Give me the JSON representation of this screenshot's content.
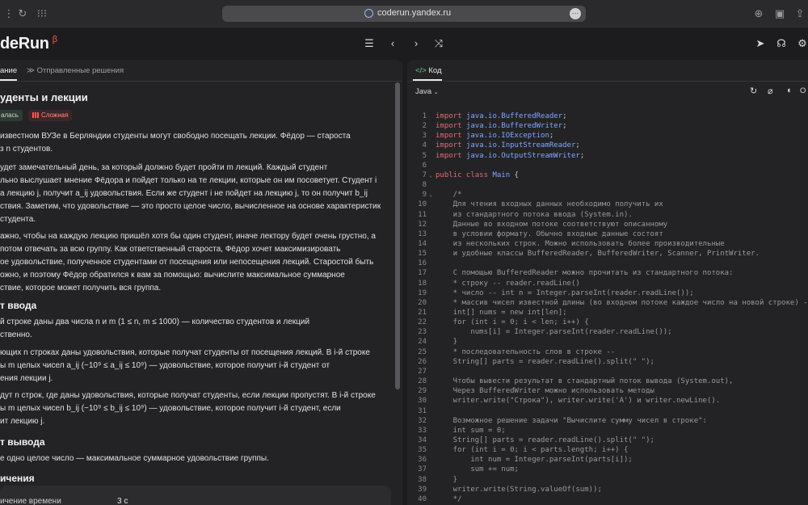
{
  "browser": {
    "url": "coderun.yandex.ru"
  },
  "app": {
    "logo": "deRun",
    "beta": "β"
  },
  "left_panel": {
    "tabs": [
      "ание",
      "Отправленные решения"
    ],
    "problem": {
      "title": "уденты и лекции",
      "badge_status": "алась",
      "badge_difficulty": "Сложная",
      "statement": [
        "известном ВУЗе в Берляндии студенты могут свободно посещать лекции. Фёдор — староста",
        "з n студентов.",
        "удет замечательный день, за который должно будет пройти m лекций. Каждый студент",
        "льно выслушает мнение Фёдора и пойдет только на те лекции, которые он им посоветует. Студент i",
        "а лекцию j, получит a_ij удовольствия. Если же студент i не пойдет на лекцию j, то он получит b_ij",
        "ствия. Заметим, что удовольствие — это просто целое число, вычисленное на основе характеристик",
        "студента.",
        "ажно, чтобы на каждую лекцию пришёл хотя бы один студент, иначе лектору будет очень грустно, а",
        "потом отвечать за всю группу. Как ответственный староста, Фёдор хочет максимизировать",
        "ое удовольствие, полученное студентами от посещения или непосещения лекций. Старостой быть",
        "ожно, и поэтому Фёдор обратился к вам за помощью: вычислите максимальное суммарное",
        "ствие, которое может получить вся группа."
      ],
      "input_heading": "т ввода",
      "input": [
        "й строке даны два числа n и m (1 ≤ n, m ≤ 1000) — количество студентов и лекций",
        "ственно.",
        "ющих n строках даны удовольствия, которые получат студенты от посещения лекций. В i-й строке",
        "ы m целых чисел a_ij (−10⁹ ≤ a_ij ≤ 10⁹) — удовольствие, которое получит i-й студент от",
        "ения лекции j.",
        "дут n строк, где даны удовольствия, которые получат студенты, если лекции пропустят. В i-й строке",
        "ы m целых чисел b_ij (−10⁹ ≤ b_ij ≤ 10⁹) — удовольствие, которое получит i-й студент, если",
        "ит лекцию j."
      ],
      "output_heading": "т вывода",
      "output": [
        "е одно целое число — максимальное суммарное удовольствие группы."
      ],
      "limits_heading": "ичения",
      "limits_row_label": "ичение времени",
      "limits_row_value": "3 с"
    }
  },
  "right_panel": {
    "tab": "Код",
    "language": "Java",
    "toolbar_right_label": "O",
    "code_lines": [
      "import java.io.BufferedReader;",
      "import java.io.BufferedWriter;",
      "import java.io.IOException;",
      "import java.io.InputStreamReader;",
      "import java.io.OutputStreamWriter;",
      "",
      "public class Main {",
      "",
      "    /*",
      "    Для чтения входных данных необходимо получить их",
      "    из стандартного потока ввода (System.in).",
      "    Данные во входном потоке соответствуют описанному",
      "    в условии формату. Обычно входные данные состоят",
      "    из нескольких строк. Можно использовать более производительные",
      "    и удобные классы BufferedReader, BufferedWriter, Scanner, PrintWriter.",
      "",
      "    С помощью BufferedReader можно прочитать из стандартного потока:",
      "    * строку -- reader.readLine()",
      "    * число -- int n = Integer.parseInt(reader.readLine());",
      "    * массив чисел известной длины (во входном потоке каждое число на новой строке) --",
      "    int[] nums = new int[len];",
      "    for (int i = 0; i < len; i++) {",
      "        nums[i] = Integer.parseInt(reader.readLine());",
      "    }",
      "    * последовательность слов в строке --",
      "    String[] parts = reader.readLine().split(\" \");",
      "",
      "    Чтобы вывести результат в стандартный поток вывода (System.out),",
      "    Через BufferedWriter можно использовать методы",
      "    writer.write(\"Строка\"), writer.write('A') и writer.newLine().",
      "",
      "    Возможное решение задачи \"Вычислите сумму чисел в строке\":",
      "    int sum = 0;",
      "    String[] parts = reader.readLine().split(\" \");",
      "    for (int i = 0; i < parts.length; i++) {",
      "        int num = Integer.parseInt(parts[i]);",
      "        sum += num;",
      "    }",
      "    writer.write(String.valueOf(sum));",
      "    */"
    ]
  }
}
